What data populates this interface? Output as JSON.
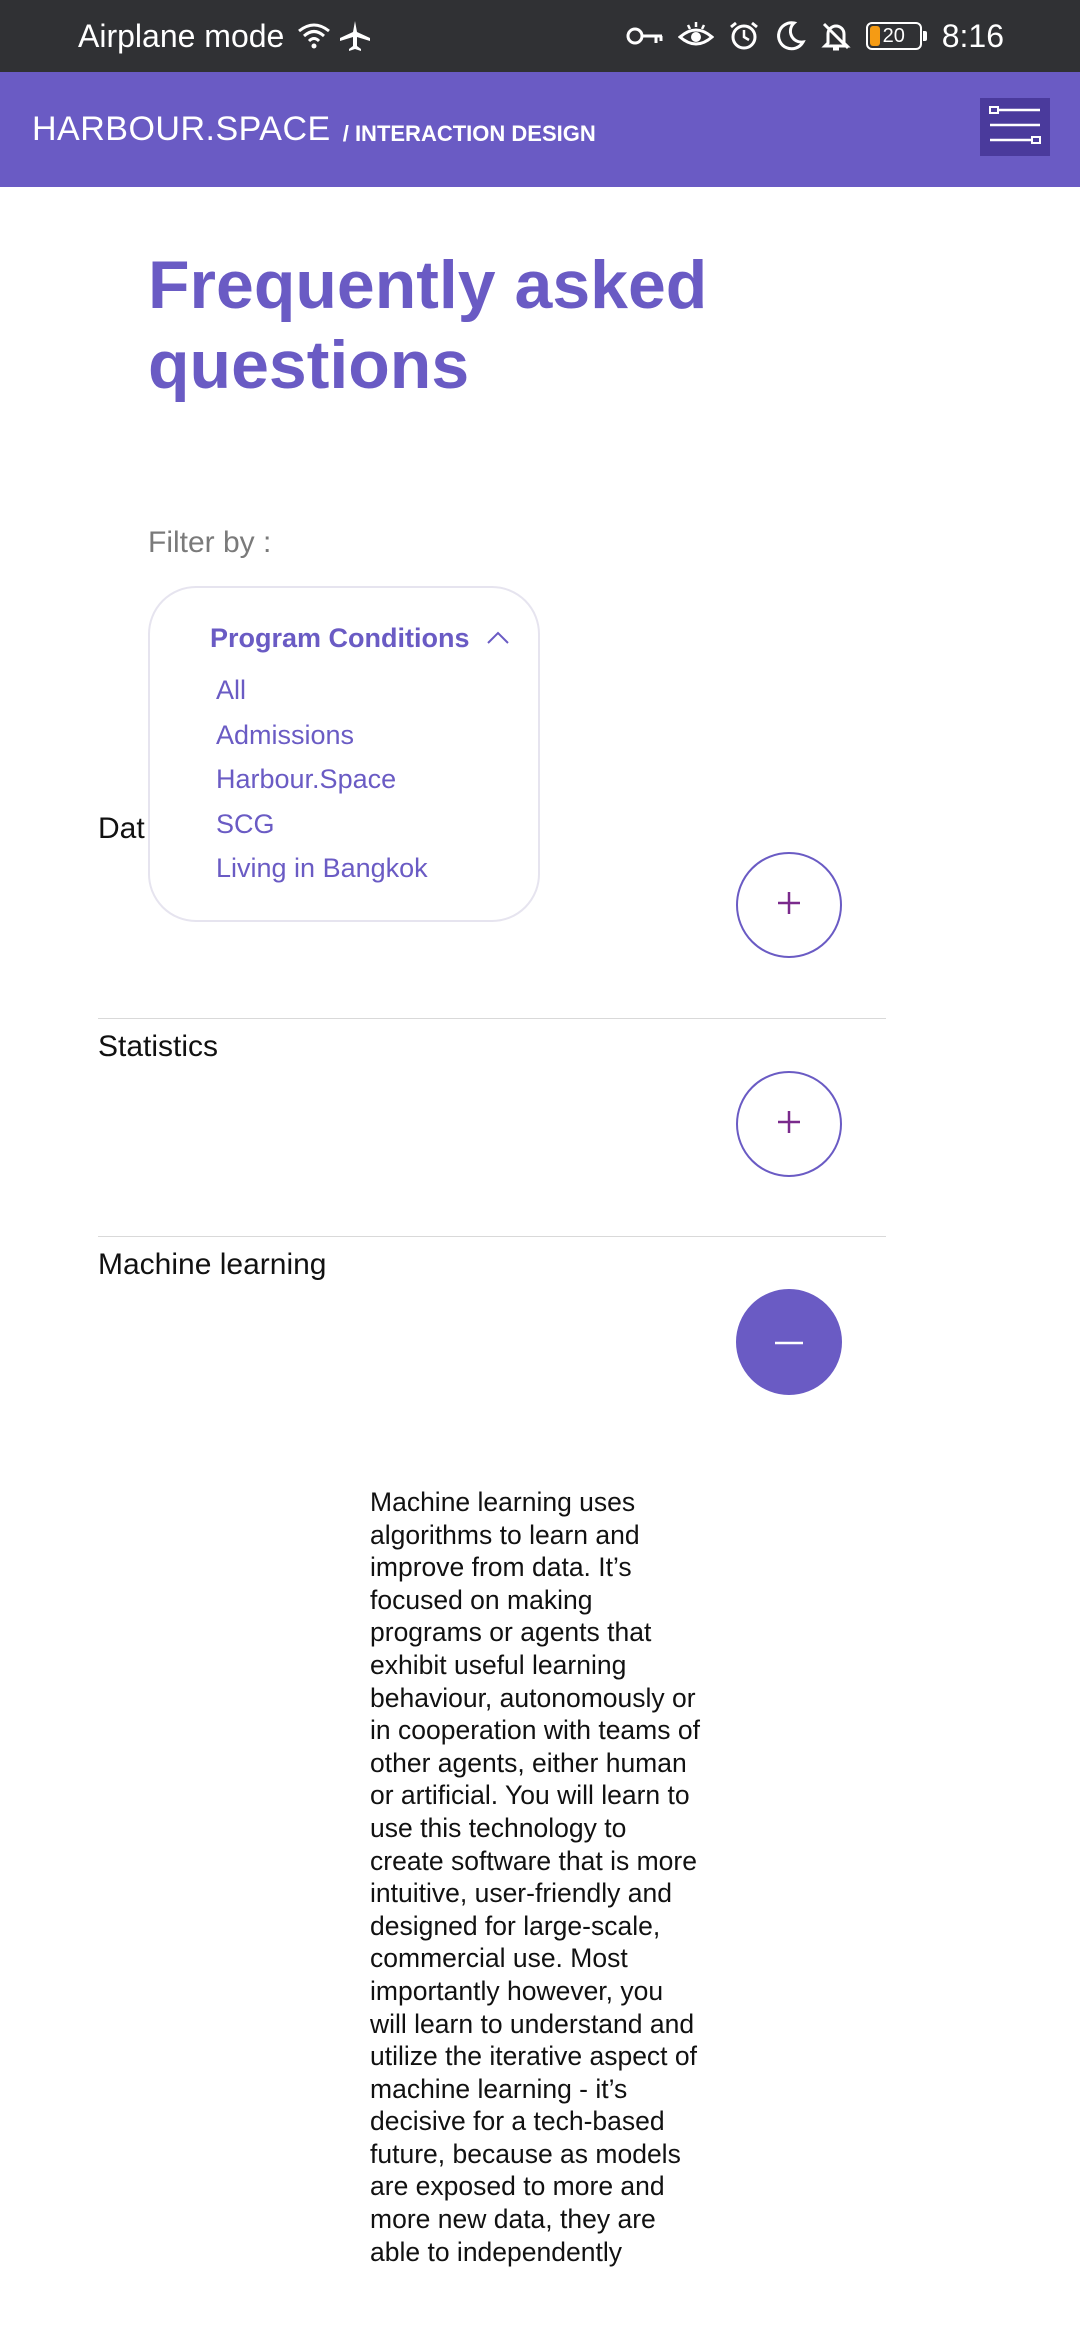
{
  "status_bar": {
    "airplane_label": "Airplane mode",
    "battery_level": "20",
    "time": "8:16",
    "icons": [
      "wifi-icon",
      "airplane-icon",
      "key-icon",
      "eye-icon",
      "alarm-icon",
      "moon-icon",
      "bell-off-icon",
      "battery-icon"
    ]
  },
  "header": {
    "brand": "HARBOUR.SPACE",
    "section": "/ INTERACTION DESIGN",
    "menu_icon": "menu-icon"
  },
  "main": {
    "title": "Frequently asked questions",
    "filter_label": "Filter by :",
    "filter": {
      "selected": "Program Conditions",
      "options": [
        "All",
        "Admissions",
        "Harbour.Space",
        "SCG",
        "Living in Bangkok"
      ]
    },
    "faq_items": [
      {
        "question": "Dat",
        "state": "collapsed"
      },
      {
        "question": "Statistics",
        "state": "collapsed"
      },
      {
        "question": "Machine learning",
        "state": "expanded"
      }
    ],
    "answer": "Machine learning uses algorithms to learn and improve from data. It’s focused on making programs or agents that exhibit useful learning behaviour, autonomously or in cooperation with teams of other agents, either human or artificial. You will learn to use this technology to create software that is more intuitive, user-friendly and designed for large-scale, commercial use. Most importantly however, you will learn to understand and utilize the iterative aspect of machine learning - it’s decisive for a tech-based future, because as models are exposed to more and more new data, they are able to independently"
  },
  "colors": {
    "brand": "#6a5bc4",
    "status_bar": "#303134",
    "menu_button": "#4a3a9c",
    "battery": "#f59b14"
  }
}
